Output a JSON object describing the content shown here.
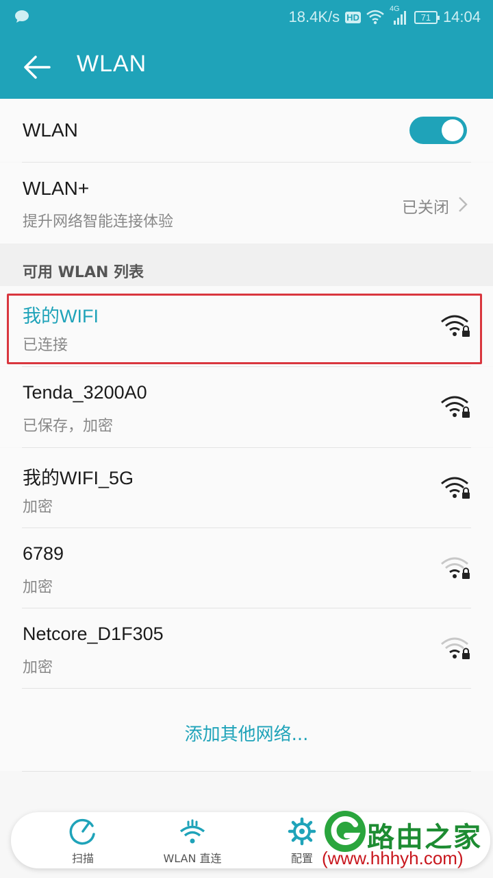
{
  "status_bar": {
    "speed": "18.4K/s",
    "hd_badge": "HD",
    "network_type": "4G",
    "battery": "71",
    "time": "14:04"
  },
  "app_bar": {
    "title": "WLAN"
  },
  "wlan_toggle": {
    "label": "WLAN",
    "state": "on"
  },
  "wlan_plus": {
    "label": "WLAN+",
    "subtitle": "提升网络智能连接体验",
    "status": "已关闭"
  },
  "section": {
    "title": "可用 WLAN 列表"
  },
  "networks": [
    {
      "name": "我的WIFI",
      "status": "已连接",
      "signal": "strong",
      "locked": true,
      "connected": true
    },
    {
      "name": "Tenda_3200A0",
      "status": "已保存，加密",
      "signal": "strong",
      "locked": true
    },
    {
      "name": "我的WIFI_5G",
      "status": "加密",
      "signal": "strong",
      "locked": true
    },
    {
      "name": "6789",
      "status": "加密",
      "signal": "weak",
      "locked": true
    },
    {
      "name": "Netcore_D1F305",
      "status": "加密",
      "signal": "weak",
      "locked": true
    }
  ],
  "add_network": {
    "label": "添加其他网络..."
  },
  "bottom_bar": {
    "items": [
      {
        "label": "扫描",
        "icon": "scan-icon"
      },
      {
        "label": "WLAN 直连",
        "icon": "wifi-direct-icon"
      },
      {
        "label": "配置",
        "icon": "gear-icon"
      }
    ]
  },
  "watermark": {
    "brand": "路由之家",
    "url": "(www.hhhyh.com)"
  },
  "colors": {
    "accent": "#1fa3b9",
    "highlight": "#d9363e",
    "brand_green": "#1d8c32",
    "brand_red": "#c8161d"
  }
}
